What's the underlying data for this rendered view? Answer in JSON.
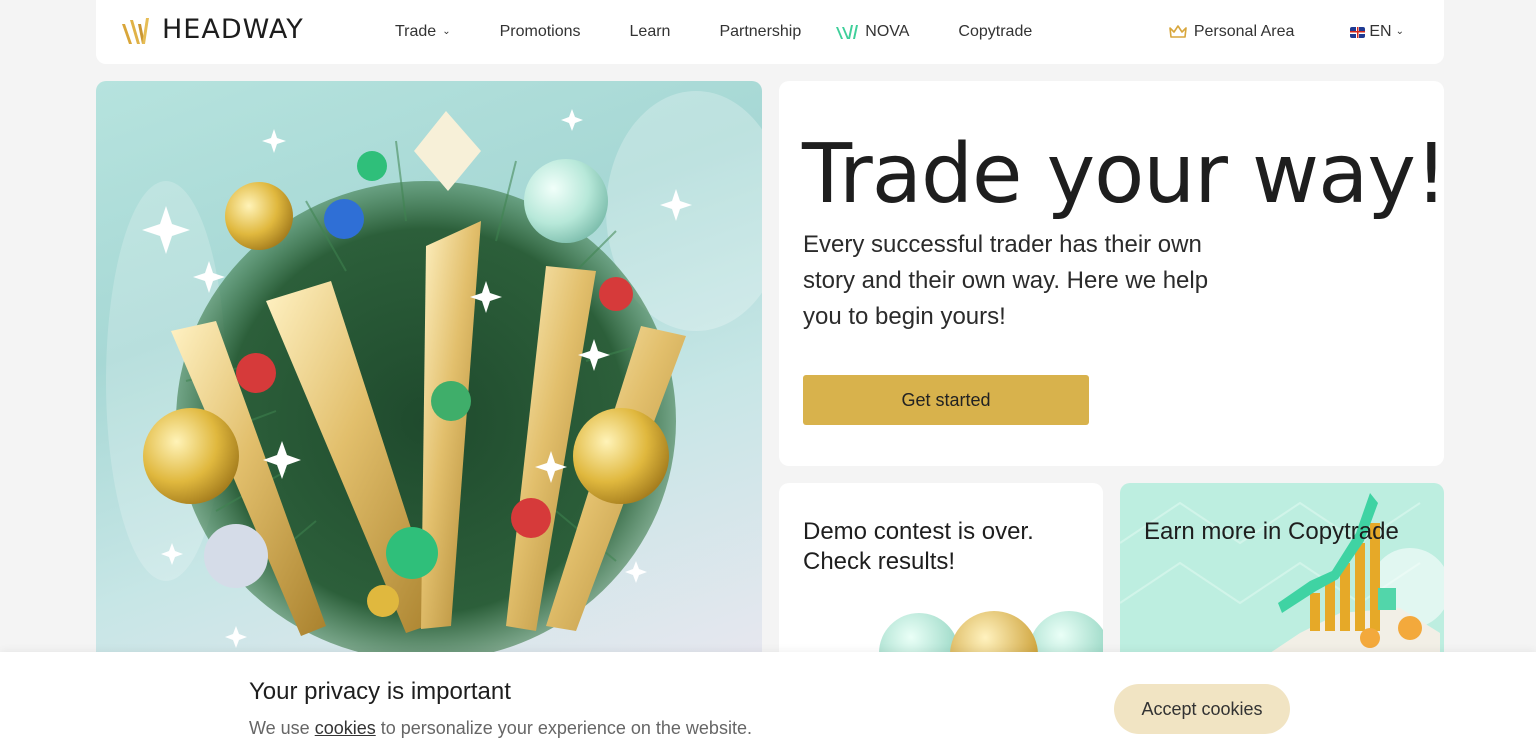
{
  "brand": {
    "name": "HEADWAY",
    "accent": "#d8b24c",
    "teal": "#3fcf9a"
  },
  "nav": {
    "items": [
      {
        "label": "Trade",
        "has_dropdown": true
      },
      {
        "label": "Promotions"
      },
      {
        "label": "Learn"
      },
      {
        "label": "Partnership"
      },
      {
        "label": "NOVA",
        "icon": "nova-logo-icon"
      },
      {
        "label": "Copytrade"
      }
    ],
    "personal_area": "Personal Area",
    "language": "EN"
  },
  "hero": {
    "title": "Trade your way!",
    "subtitle": "Every successful trader has their own story and their own way. Here we help you to begin yours!",
    "cta": "Get started"
  },
  "cards": {
    "demo": {
      "title": "Demo contest is over. Check results!"
    },
    "copytrade": {
      "title": "Earn more in Copytrade"
    }
  },
  "cookie": {
    "title": "Your privacy is important",
    "text_before": "We use ",
    "link": "cookies",
    "text_after": " to personalize your experience on the website.",
    "accept": "Accept cookies"
  }
}
